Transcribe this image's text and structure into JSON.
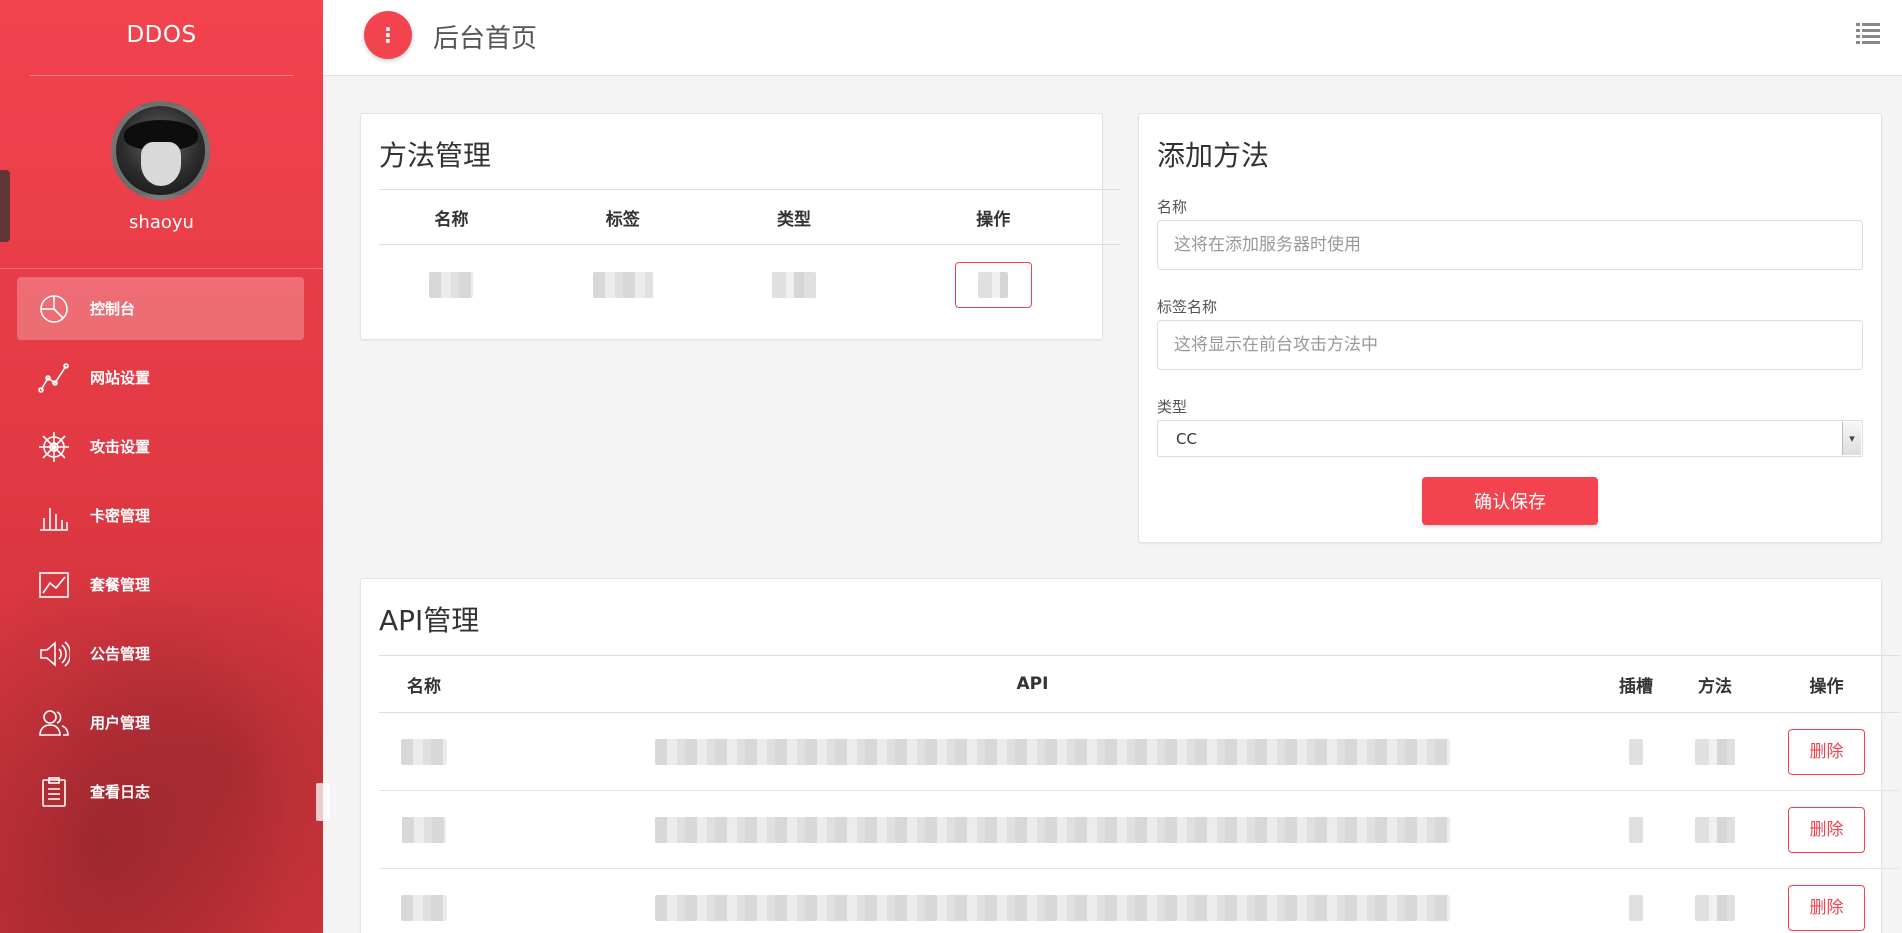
{
  "sidebar": {
    "brand": "DDOS",
    "username": "shaoyu",
    "items": [
      {
        "label": "控制台",
        "icon": "pie-chart-icon",
        "active": true
      },
      {
        "label": "网站设置",
        "icon": "line-graph-icon",
        "active": false
      },
      {
        "label": "攻击设置",
        "icon": "ship-wheel-icon",
        "active": false
      },
      {
        "label": "卡密管理",
        "icon": "bar-chart-icon",
        "active": false
      },
      {
        "label": "套餐管理",
        "icon": "area-chart-icon",
        "active": false
      },
      {
        "label": "公告管理",
        "icon": "speaker-icon",
        "active": false
      },
      {
        "label": "用户管理",
        "icon": "users-icon",
        "active": false
      },
      {
        "label": "查看日志",
        "icon": "clipboard-icon",
        "active": false
      }
    ]
  },
  "header": {
    "menu_button": "⋮",
    "title": "后台首页"
  },
  "methods": {
    "title": "方法管理",
    "columns": [
      "名称",
      "标签",
      "类型",
      "操作"
    ]
  },
  "add_method": {
    "title": "添加方法",
    "name_label": "名称",
    "name_placeholder": "这将在添加服务器时使用",
    "tag_label": "标签名称",
    "tag_placeholder": "这将显示在前台攻击方法中",
    "type_label": "类型",
    "type_value": "CC",
    "save_button": "确认保存"
  },
  "api": {
    "title": "API管理",
    "columns": [
      "名称",
      "API",
      "插槽",
      "方法",
      "操作"
    ],
    "delete_label": "删除",
    "row_count": 3
  },
  "colors": {
    "accent": "#f2434f",
    "background": "#f4f4f4"
  }
}
